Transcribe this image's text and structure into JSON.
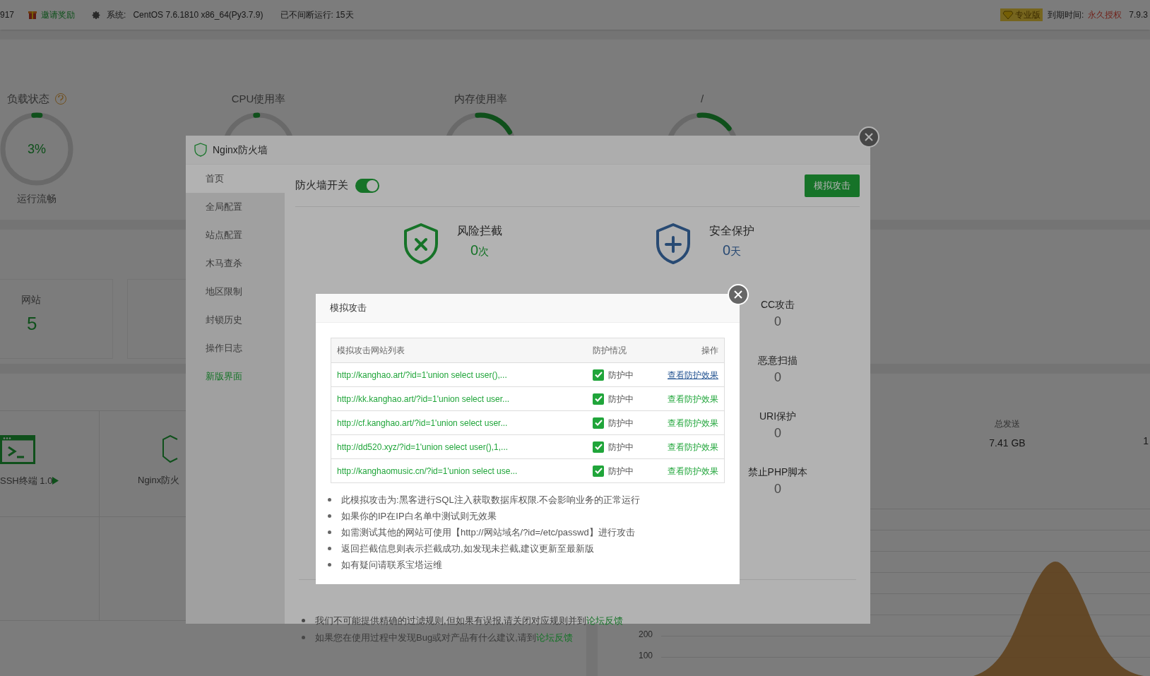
{
  "top_bar": {
    "cut_number": "917",
    "invite": "邀请奖励",
    "system_label": "系统:",
    "system_value": "CentOS 7.6.1810 x86_64(Py3.7.9)",
    "uptime": "已不间断运行: 15天",
    "edition": "专业版",
    "expiry_label": "到期时间:",
    "expiry_value": "永久授权",
    "version": "7.9.3"
  },
  "gauges": [
    {
      "title": "负载状态",
      "help": true,
      "level": 0.03,
      "value": "3%",
      "caption": "运行流畅"
    },
    {
      "title": "CPU使用率",
      "help": false,
      "level": 0.01
    },
    {
      "title": "内存使用率",
      "help": false,
      "level": 0.18
    },
    {
      "title": "/",
      "help": false,
      "level": 0.16
    }
  ],
  "overview_cards": [
    {
      "label": "网站",
      "value": "5"
    }
  ],
  "software": [
    {
      "kind": "terminal",
      "name": "SSH终端 1.0"
    },
    {
      "kind": "waf",
      "name": "Nginx防火"
    }
  ],
  "traffic": {
    "label": "总发送",
    "value": "7.41 GB",
    "cut_value": "1",
    "y_ticks": [
      "200",
      "100"
    ]
  },
  "firewall_modal": {
    "title": "Nginx防火墙",
    "nav": [
      {
        "label": "首页",
        "selected": true,
        "kind": "item"
      },
      {
        "label": "全局配置",
        "selected": false,
        "kind": "item"
      },
      {
        "label": "站点配置",
        "selected": false,
        "kind": "item"
      },
      {
        "label": "木马查杀",
        "selected": false,
        "kind": "item"
      },
      {
        "label": "地区限制",
        "selected": false,
        "kind": "item"
      },
      {
        "label": "封锁历史",
        "selected": false,
        "kind": "item"
      },
      {
        "label": "操作日志",
        "selected": false,
        "kind": "item"
      },
      {
        "label": "新版界面",
        "selected": false,
        "kind": "link"
      }
    ],
    "switch_label": "防火墙开关",
    "switch_on": true,
    "simulate_button": "模拟攻击",
    "stats": [
      {
        "kind": "blocked",
        "label": "风险拦截",
        "value": "0",
        "unit": "次"
      },
      {
        "kind": "protected",
        "label": "安全保护",
        "value": "0",
        "unit": "天"
      }
    ],
    "counters": [
      {
        "label": "CC攻击",
        "value": "0"
      },
      {
        "label": "恶意扫描",
        "value": "0"
      },
      {
        "label": "URI保护",
        "value": "0"
      },
      {
        "label": "禁止PHP脚本",
        "value": "0"
      }
    ],
    "notes": [
      {
        "text": "我们不可能提供精确的过滤规则,但如果有误报,请关闭对应规则并到",
        "link": "论坛反馈"
      },
      {
        "text": "如果您在使用过程中发现Bug或对产品有什么建议,请到",
        "link": "论坛反馈"
      }
    ]
  },
  "attack_dialog": {
    "title": "模拟攻击",
    "columns": [
      "模拟攻击网站列表",
      "防护情况",
      "操作"
    ],
    "rows": [
      {
        "url": "http://kanghao.art/?id=1'union select user(),...",
        "checked": true,
        "status": "防护中",
        "action": "查看防护效果",
        "hovered": true
      },
      {
        "url": "http://kk.kanghao.art/?id=1'union select user...",
        "checked": true,
        "status": "防护中",
        "action": "查看防护效果",
        "hovered": false
      },
      {
        "url": "http://cf.kanghao.art/?id=1'union select user...",
        "checked": true,
        "status": "防护中",
        "action": "查看防护效果",
        "hovered": false
      },
      {
        "url": "http://dd520.xyz/?id=1'union select user(),1,...",
        "checked": true,
        "status": "防护中",
        "action": "查看防护效果",
        "hovered": false
      },
      {
        "url": "http://kanghaomusic.cn/?id=1'union select use...",
        "checked": true,
        "status": "防护中",
        "action": "查看防护效果",
        "hovered": false
      }
    ],
    "notes": [
      "此模拟攻击为:黑客进行SQL注入获取数据库权限.不会影响业务的正常运行",
      "如果你的IP在IP白名单中测试则无效果",
      "如需测试其他的网站可使用【http://网站域名/?id=/etc/passwd】进行攻击",
      "返回拦截信息则表示拦截成功,如发现未拦截,建议更新至最新版",
      "如有疑问请联系宝塔运维"
    ]
  }
}
